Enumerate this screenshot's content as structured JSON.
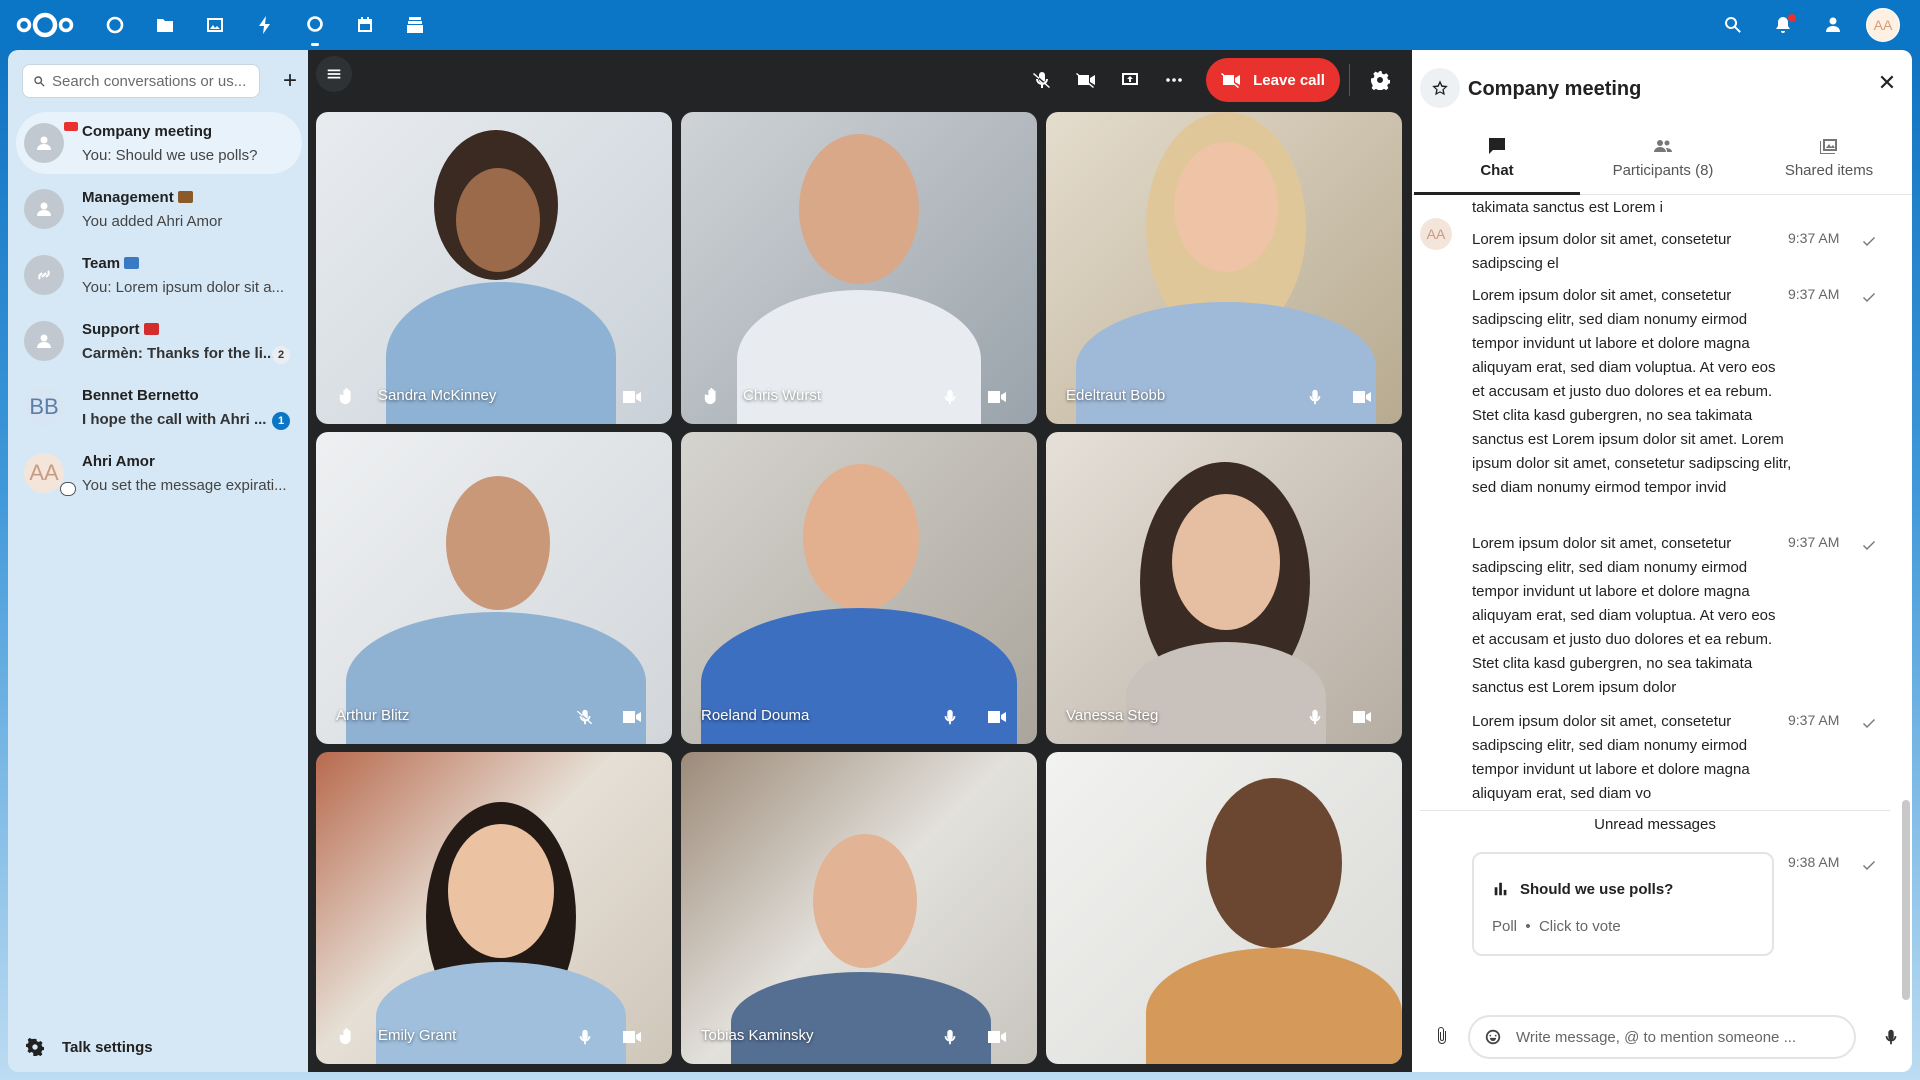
{
  "topbar": {
    "apps": [
      "dashboard-icon",
      "files-icon",
      "photos-icon",
      "activity-icon",
      "talk-icon",
      "calendar-icon",
      "deck-icon"
    ],
    "user_initials": "AA"
  },
  "sidebar": {
    "search_placeholder": "Search conversations or us...",
    "add_button": "+",
    "conversations": [
      {
        "title": "Company meeting",
        "subtitle": "You: Should we use polls?",
        "active": true
      },
      {
        "title": "Management",
        "subtitle": "You added Ahri Amor"
      },
      {
        "title": "Team",
        "subtitle": "You: Lorem ipsum dolor sit a..."
      },
      {
        "title": "Support",
        "subtitle": "Carmèn: Thanks for the li...",
        "badge": "2"
      },
      {
        "title": "Bennet Bernetto",
        "subtitle": "I hope the call with Ahri ...",
        "badge": "1",
        "initials": "BB"
      },
      {
        "title": "Ahri Amor",
        "subtitle": "You set the message expirati...",
        "initials": "AA"
      }
    ],
    "footer": "Talk settings"
  },
  "call": {
    "leave_label": "Leave call",
    "tiles": [
      {
        "name": "Sandra McKinney",
        "hand": true
      },
      {
        "name": "Chris Wurst",
        "hand": true
      },
      {
        "name": "Edeltraut Bobb"
      },
      {
        "name": "Arthur Blitz"
      },
      {
        "name": "Roeland Douma"
      },
      {
        "name": "Vanessa Steg"
      },
      {
        "name": "Emily Grant",
        "hand": true
      },
      {
        "name": "Tobias Kaminsky"
      },
      {
        "name": ""
      }
    ]
  },
  "panel": {
    "title": "Company meeting",
    "tabs": [
      "Chat",
      "Participants (8)",
      "Shared items"
    ],
    "chat_avatar": "AA",
    "top_fragment": "takimata sanctus est Lorem i",
    "messages": [
      {
        "text": "Lorem ipsum dolor sit amet, consetetur sadipscing el",
        "time": "9:37 AM"
      },
      {
        "text": "Lorem ipsum dolor sit amet, consetetur sadipscing elitr, sed diam nonumy eirmod tempor invidunt ut labore et dolore magna aliquyam erat, sed diam voluptua. At vero eos et accusam et justo duo dolores et ea rebum. Stet clita kasd gubergren, no sea takimata sanctus est Lorem ipsum dolor sit amet. Lorem ipsum dolor sit amet, consetetur sadipscing elitr, sed diam nonumy eirmod tempor invid",
        "time": "9:37 AM"
      },
      {
        "text": "Lorem ipsum dolor sit amet, consetetur sadipscing elitr, sed diam nonumy eirmod tempor invidunt ut labore et dolore magna aliquyam erat, sed diam voluptua. At vero eos et accusam et justo duo dolores et ea rebum. Stet clita kasd gubergren, no sea takimata sanctus est Lorem ipsum dolor",
        "time": "9:37 AM"
      },
      {
        "text": "Lorem ipsum dolor sit amet, consetetur sadipscing elitr, sed diam nonumy eirmod tempor invidunt ut labore et dolore magna aliquyam erat, sed diam vo",
        "time": "9:37 AM"
      }
    ],
    "unread_label": "Unread messages",
    "poll": {
      "title": "Should we use polls?",
      "type": "Poll",
      "separator": "•",
      "action": "Click to vote",
      "time": "9:38 AM"
    },
    "composer_placeholder": "Write message, @ to mention someone ..."
  },
  "colors": {
    "brand": "#0b76c6",
    "leave": "#e9322d"
  }
}
